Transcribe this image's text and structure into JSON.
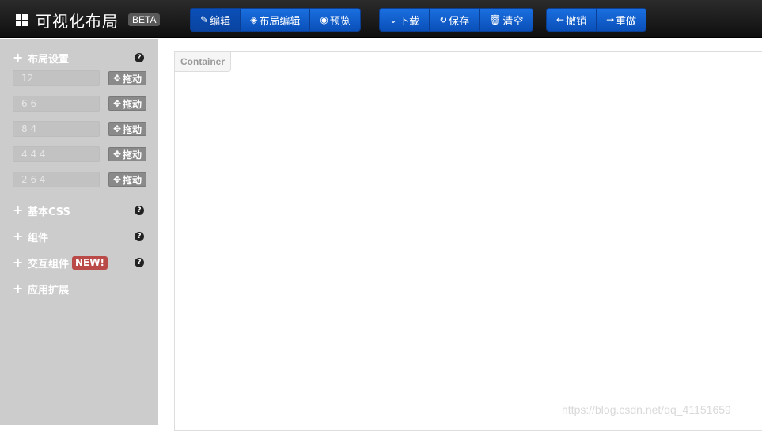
{
  "navbar": {
    "title": "可视化布局",
    "beta": "BETA",
    "groups": [
      [
        {
          "icon": "✎",
          "label": "编辑",
          "active": true
        },
        {
          "icon": "◈",
          "label": "布局编辑"
        },
        {
          "icon": "◉",
          "label": "预览"
        }
      ],
      [
        {
          "icon": "⌄",
          "label": "下载"
        },
        {
          "icon": "↻",
          "label": "保存"
        },
        {
          "icon": "🗑",
          "label": "清空"
        }
      ],
      [
        {
          "icon": "←",
          "label": "撤销"
        },
        {
          "icon": "→",
          "label": "重做"
        }
      ]
    ]
  },
  "sidebar": {
    "layout_section": {
      "label": "布局设置",
      "help": "?"
    },
    "layout_rows": [
      {
        "value": "12",
        "drag_label": "拖动"
      },
      {
        "value": "6 6",
        "drag_label": "拖动"
      },
      {
        "value": "8 4",
        "drag_label": "拖动"
      },
      {
        "value": "4 4 4",
        "drag_label": "拖动"
      },
      {
        "value": "2 6 4",
        "drag_label": "拖动"
      }
    ],
    "sections": [
      {
        "label": "基本CSS",
        "help": "?"
      },
      {
        "label": "组件",
        "help": "?"
      },
      {
        "label": "交互组件",
        "badge": "NEW!",
        "help": "?"
      },
      {
        "label": "应用扩展"
      }
    ]
  },
  "canvas": {
    "container_label": "Container"
  },
  "watermark": "https://blog.csdn.net/qq_41151659"
}
